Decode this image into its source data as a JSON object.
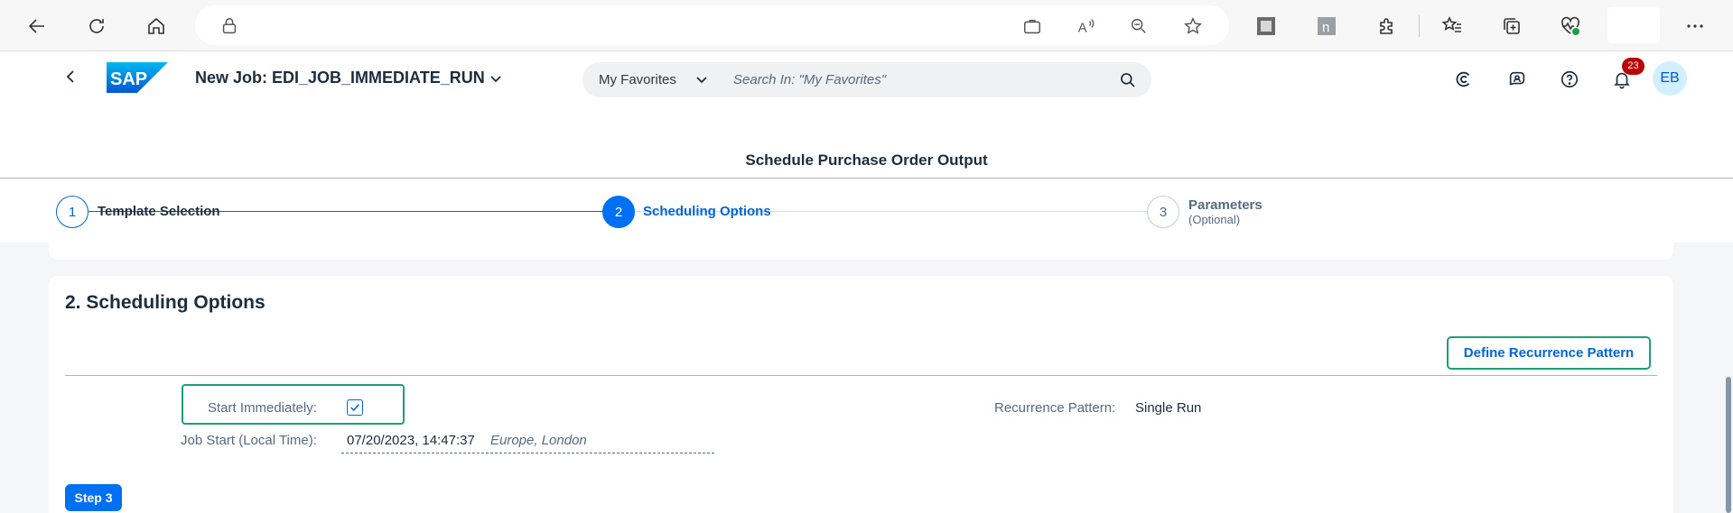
{
  "browser": {
    "icons": [
      "back-icon",
      "refresh-icon",
      "home-icon",
      "lock-icon",
      "briefcase-icon",
      "read-aloud-icon",
      "zoom-out-icon",
      "favorite-star-icon",
      "extension-icon",
      "n-extension-icon",
      "puzzle-icon",
      "favorites-list-icon",
      "collections-icon",
      "health-icon",
      "more-icon"
    ],
    "read_aloud_glyph": "A",
    "n_extension_glyph": "n"
  },
  "shell": {
    "logo_text": "SAP",
    "app_title": "New Job: EDI_JOB_IMMEDIATE_RUN",
    "search_scope": "My Favorites",
    "search_placeholder": "Search In: \"My Favorites\"",
    "notification_count": "23",
    "avatar_initials": "EB"
  },
  "page": {
    "title": "Schedule Purchase Order Output"
  },
  "wizard": {
    "steps": [
      {
        "number": "1",
        "label": "Template Selection",
        "sublabel": ""
      },
      {
        "number": "2",
        "label": "Scheduling Options",
        "sublabel": ""
      },
      {
        "number": "3",
        "label": "Parameters",
        "sublabel": "(Optional)"
      }
    ],
    "active_step": 2
  },
  "section": {
    "title": "2. Scheduling Options",
    "define_recurrence_label": "Define Recurrence Pattern",
    "start_immediately_label": "Start Immediately:",
    "start_immediately_checked": true,
    "job_start_label": "Job Start (Local Time):",
    "job_start_value": "07/20/2023, 14:47:37",
    "job_start_timezone": "Europe, London",
    "recurrence_label": "Recurrence Pattern:",
    "recurrence_value": "Single Run",
    "next_step_label": "Step 3"
  },
  "colors": {
    "accent": "#0070f2",
    "highlight_border": "#1e9e78",
    "badge": "#bb0000",
    "avatar_bg": "#d1efff"
  }
}
